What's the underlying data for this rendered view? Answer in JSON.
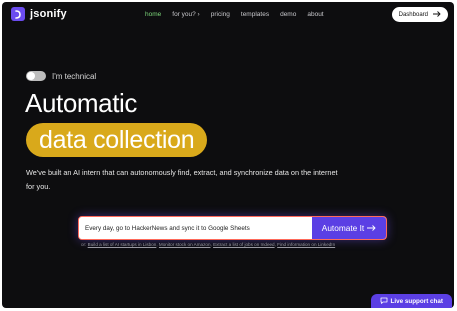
{
  "brand": {
    "name": "jsonify",
    "logo_icon": "jsonify-logo-icon",
    "accent_color": "#6b4cf0"
  },
  "nav": {
    "links": [
      {
        "label": "home",
        "active": true
      },
      {
        "label": "for you? ›",
        "active": false
      },
      {
        "label": "pricing",
        "active": false
      },
      {
        "label": "templates",
        "active": false
      },
      {
        "label": "demo",
        "active": false
      },
      {
        "label": "about",
        "active": false
      }
    ],
    "active_color": "#7cd67a",
    "dashboard_label": "Dashboard",
    "dashboard_icon": "arrow-right-icon"
  },
  "toggle": {
    "label": "I'm technical",
    "on": false
  },
  "hero": {
    "title": "Automatic",
    "highlight": "data collection",
    "highlight_color": "#d9a91b",
    "description": "We've built an AI intern that can autonomously find, extract, and synchronize data on the internet for you."
  },
  "search": {
    "value": "Every day, go to HackerNews and sync it to Google Sheets",
    "button_label": "Automate It",
    "button_icon": "arrow-right-icon",
    "button_color": "#5b3fe4"
  },
  "suggestions": {
    "prefix": "or:",
    "items": [
      "Build a list of AI startups in Lisbon",
      "Monitor stock on Amazon",
      "Extract a list of jobs on Indeed",
      "Find information on LinkedIn"
    ]
  },
  "live_chat": {
    "label": "Live support chat",
    "icon": "chat-bubble-icon"
  }
}
